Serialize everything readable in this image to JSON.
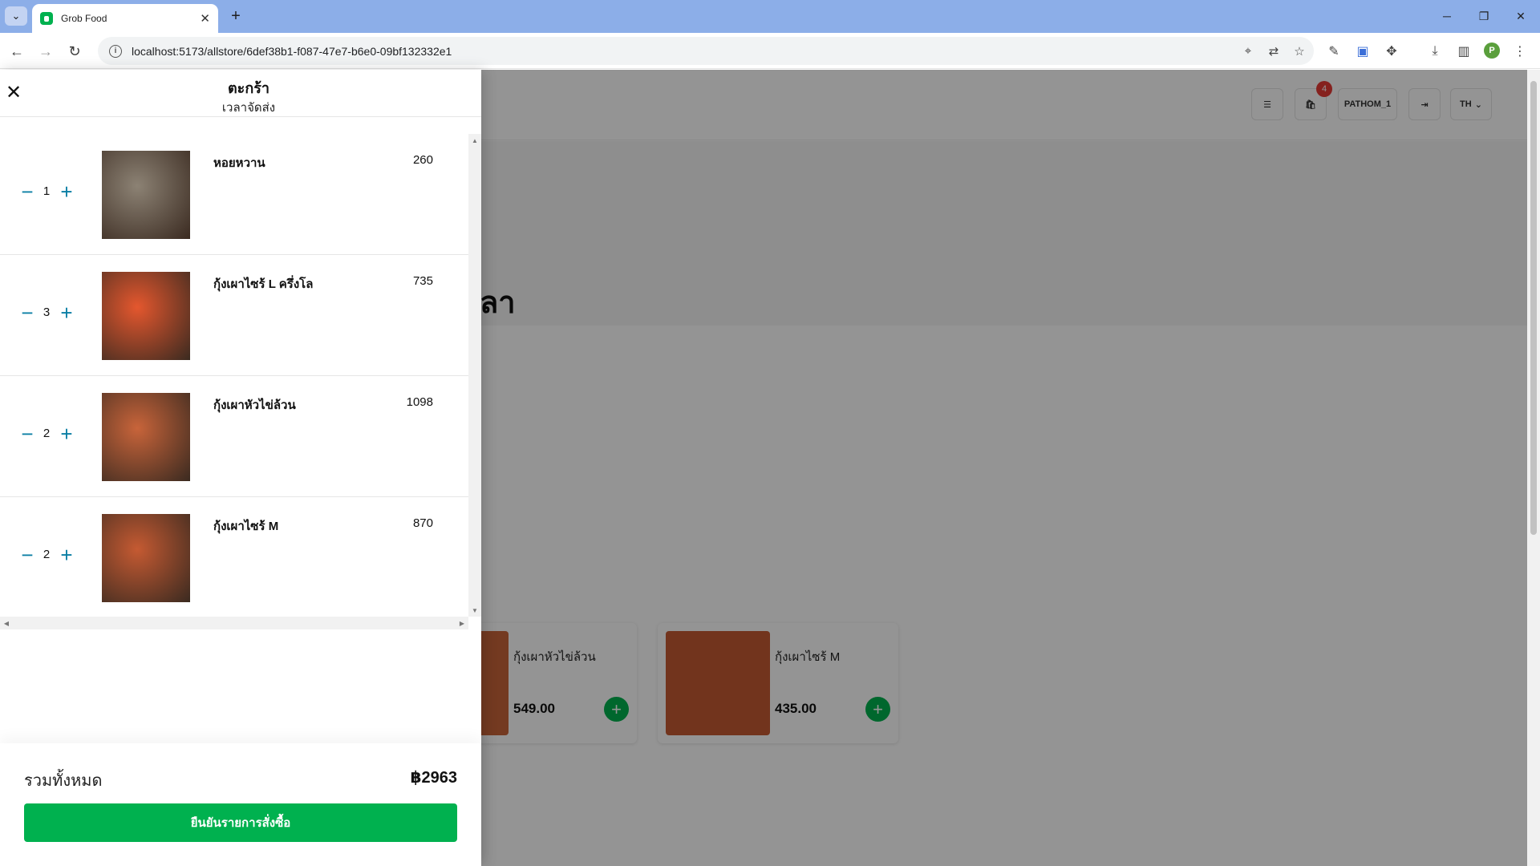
{
  "browser": {
    "tab_title": "Grob Food",
    "url": "localhost:5173/allstore/6def38b1-f087-47e7-b6e0-09bf132332e1",
    "profile_initial": "P"
  },
  "header": {
    "cart_count": "4",
    "username": "PATHOM_1",
    "language": "TH"
  },
  "hero": {
    "title_fragment": "ลา"
  },
  "products": [
    {
      "name": "กุ้งเผาหัวไข่ล้วน",
      "price": "549.00"
    },
    {
      "name": "กุ้งเผาไซร้ M",
      "price": "435.00"
    }
  ],
  "cart": {
    "title": "ตะกร้า",
    "subtitle": "เวลาจัดส่ง",
    "items": [
      {
        "name": "หอยหวาน",
        "qty": "1",
        "price": "260",
        "image_color": "#8c8274"
      },
      {
        "name": "กุ้งเผาไซร้ L ครึ่งโล",
        "qty": "3",
        "price": "735",
        "image_color": "#e4572e"
      },
      {
        "name": "กุ้งเผาหัวไข่ล้วน",
        "qty": "2",
        "price": "1098",
        "image_color": "#c8643a"
      },
      {
        "name": "กุ้งเผาไซร้ M",
        "qty": "2",
        "price": "870",
        "image_color": "#c55a32"
      }
    ],
    "total_label": "รวมทั้งหมด",
    "total_value": "฿2963",
    "confirm_label": "ยืนยันรายการสั่งซื้อ"
  },
  "colors": {
    "accent_green": "#00b14f",
    "qty_blue": "#0a7ea4",
    "badge_red": "#e53935",
    "titlebar": "#8caee8"
  },
  "icons": {
    "close": "close-icon",
    "minus": "minus-icon",
    "plus": "plus-icon",
    "cart": "shopping-bag-icon",
    "orders": "list-icon",
    "logout": "logout-icon"
  }
}
